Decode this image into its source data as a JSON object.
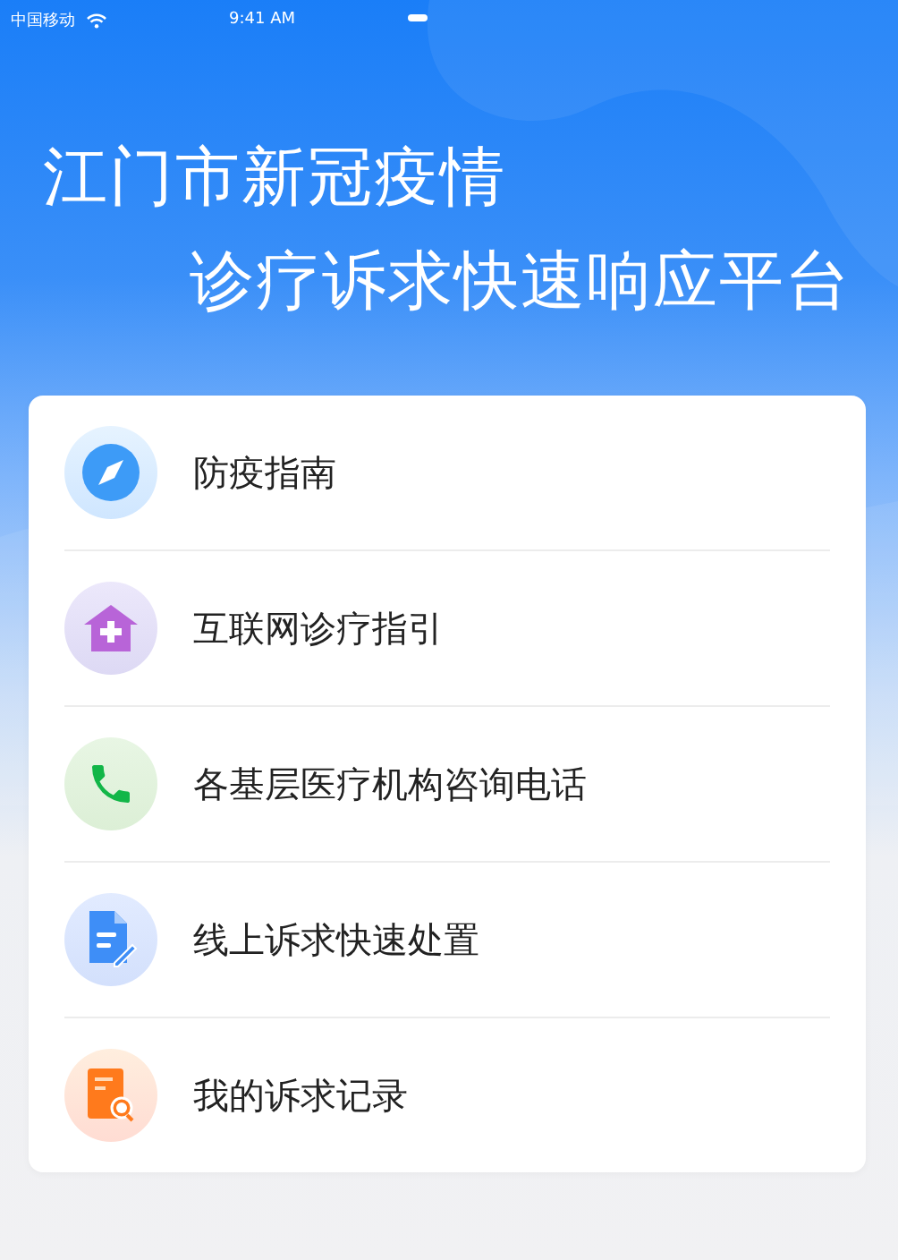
{
  "status_bar": {
    "carrier": "中国移动",
    "time": "9:41 AM"
  },
  "title": {
    "line_1": "江门市新冠疫情",
    "line_2": "诊疗诉求快速响应平台"
  },
  "menu": [
    {
      "kind": "compass",
      "label": "防疫指南"
    },
    {
      "kind": "hospital",
      "label": "互联网诊疗指引"
    },
    {
      "kind": "phone",
      "label": "各基层医疗机构咨询电话"
    },
    {
      "kind": "document",
      "label": "线上诉求快速处置"
    },
    {
      "kind": "record",
      "label": "我的诉求记录"
    }
  ]
}
